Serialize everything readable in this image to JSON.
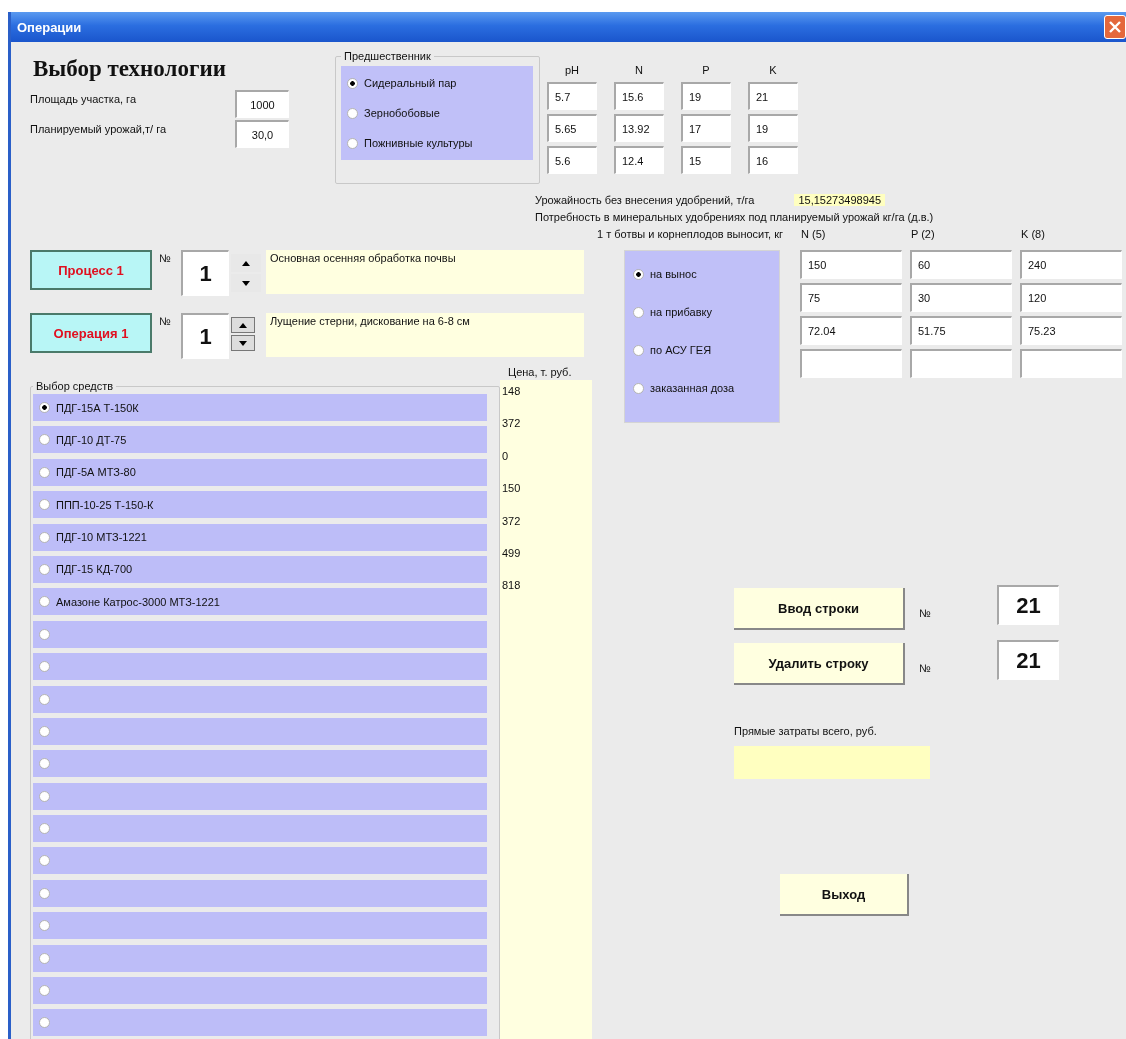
{
  "window": {
    "title": "Операции"
  },
  "heading": "Выбор технологии",
  "parameters": [
    {
      "label": "Площадь участка, га",
      "value": "1000"
    },
    {
      "label": "Планируемый урожай,т/ га",
      "value": "30,0"
    }
  ],
  "predecessor": {
    "title": "Предшественник",
    "columns": [
      "pH",
      "N",
      "P",
      "K"
    ],
    "options": [
      {
        "label": "Сидеральный пар",
        "selected": true,
        "values": [
          "5.7",
          "15.6",
          "19",
          "21"
        ]
      },
      {
        "label": "Зернобобовые",
        "selected": false,
        "values": [
          "5.65",
          "13.92",
          "17",
          "19"
        ]
      },
      {
        "label": "Пожнивные культуры",
        "selected": false,
        "values": [
          "5.6",
          "12.4",
          "15",
          "16"
        ]
      }
    ]
  },
  "yield_without_fertilizer": {
    "label": "Урожайность без внесения удобрений, т/га",
    "value": "15,15273498945"
  },
  "fertilizer_need": {
    "title": "Потребность в минеральных удобрениях под планируемый урожай кг/га (д.в.)",
    "row_label": "1 т ботвы и корнеплодов выносит, кг",
    "columns": [
      "N (5)",
      "P (2)",
      "K (8)"
    ],
    "methods": [
      {
        "label": "на вынос",
        "selected": true,
        "values": [
          "150",
          "60",
          "240"
        ]
      },
      {
        "label": "на прибавку",
        "selected": false,
        "values": [
          "75",
          "30",
          "120"
        ]
      },
      {
        "label": "по АСУ ГЕЯ",
        "selected": false,
        "values": [
          "72.04",
          "51.75",
          "75.23"
        ]
      },
      {
        "label": "заказанная доза",
        "selected": false
      }
    ]
  },
  "process": {
    "label": "Процесс 1",
    "number_label": "№",
    "number": "1",
    "description": "Основная осенняя обработка почвы"
  },
  "operation": {
    "label": "Операция 1",
    "number_label": "№",
    "number": "1",
    "description": "Лущение стерни, дискование на 6-8 см"
  },
  "means": {
    "title": "Выбор средств",
    "price_header": "Цена, т. руб.",
    "items": [
      {
        "label": "ПДГ-15А  Т-150К",
        "price": "148",
        "selected": true
      },
      {
        "label": "ПДГ-10 ДТ-75",
        "price": "372",
        "selected": false
      },
      {
        "label": "ПДГ-5А МТЗ-80",
        "price": "0",
        "selected": false
      },
      {
        "label": "ППП-10-25 Т-150-К",
        "price": "150",
        "selected": false
      },
      {
        "label": "ПДГ-10 МТЗ-1221",
        "price": "372",
        "selected": false
      },
      {
        "label": "ПДГ-15 КД-700",
        "price": "499",
        "selected": false
      },
      {
        "label": "Амазоне Катрос-3000 МТЗ-1221",
        "price": "818",
        "selected": false
      },
      {
        "selected": false
      },
      {
        "selected": false
      },
      {
        "selected": false
      },
      {
        "selected": false
      },
      {
        "selected": false
      },
      {
        "selected": false
      },
      {
        "selected": false
      },
      {
        "selected": false
      },
      {
        "selected": false
      },
      {
        "selected": false
      },
      {
        "selected": false
      },
      {
        "selected": false
      },
      {
        "selected": false
      }
    ]
  },
  "row_actions": [
    {
      "label": "Ввод строки",
      "number_label": "№",
      "number": "21"
    },
    {
      "label": "Удалить строку",
      "number_label": "№",
      "number": "21"
    }
  ],
  "total": {
    "label": "Прямые затраты всего, руб."
  },
  "exit_button": "Выход"
}
